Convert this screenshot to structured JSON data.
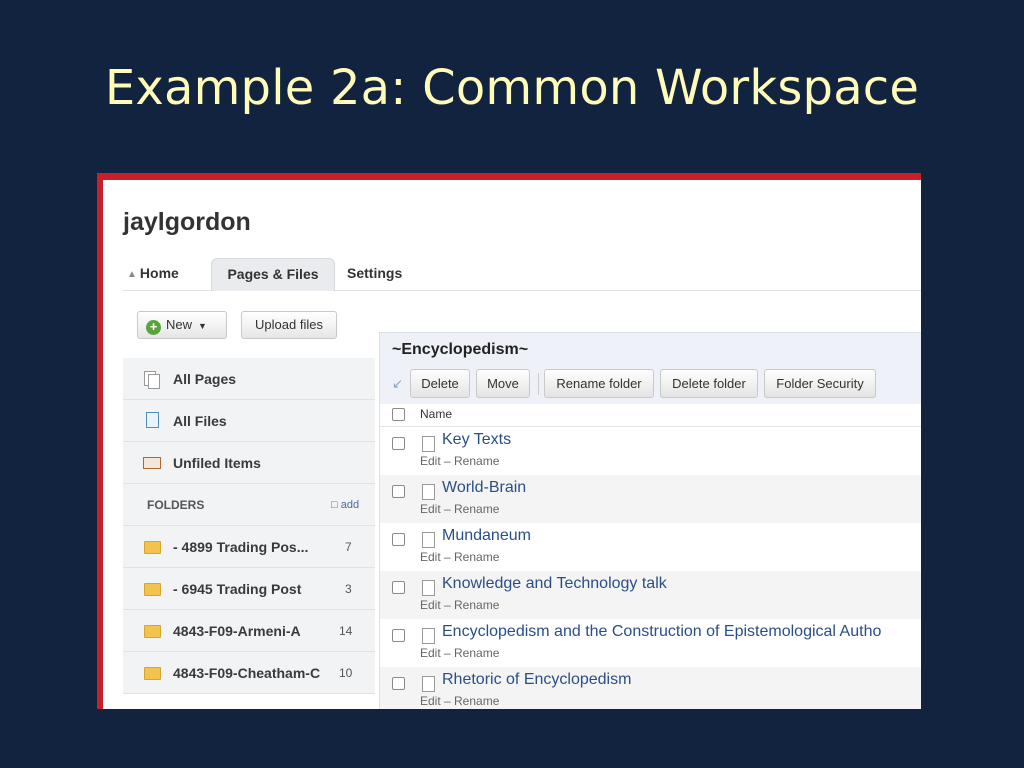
{
  "slide": {
    "title": "Example 2a: Common Workspace"
  },
  "app": {
    "user": "jaylgordon",
    "tabs": [
      {
        "label": "Home",
        "icon": "home-icon"
      },
      {
        "label": "Pages & Files"
      },
      {
        "label": "Settings"
      }
    ],
    "toolbar": {
      "new_label": "New",
      "upload_label": "Upload files"
    },
    "sidebar": {
      "items": [
        {
          "label": "All Pages",
          "icon": "pages-icon"
        },
        {
          "label": "All Files",
          "icon": "file-icon"
        },
        {
          "label": "Unfiled Items",
          "icon": "envelope-icon"
        }
      ],
      "folders_header": "FOLDERS",
      "add_label": "add",
      "folders": [
        {
          "label": "- 4899 Trading Pos...",
          "count": "7"
        },
        {
          "label": "- 6945 Trading Post",
          "count": "3"
        },
        {
          "label": "4843-F09-Armeni-A",
          "count": "14"
        },
        {
          "label": "4843-F09-Cheatham-C",
          "count": "10"
        }
      ]
    },
    "content": {
      "folder_title": "~Encyclopedism~",
      "actions": [
        "Delete",
        "Move",
        "Rename folder",
        "Delete folder",
        "Folder Security"
      ],
      "name_header": "Name",
      "links_text": "Edit – Rename",
      "rows": [
        {
          "title": "Key Texts"
        },
        {
          "title": "World-Brain"
        },
        {
          "title": "Mundaneum"
        },
        {
          "title": "Knowledge and Technology talk"
        },
        {
          "title": "Encyclopedism and the Construction of Epistemological Autho"
        },
        {
          "title": "Rhetoric of Encyclopedism"
        }
      ]
    }
  },
  "colors": {
    "background": "#12233f",
    "title": "#fffbb8",
    "frame": "#c8202a",
    "link": "#2a4f86"
  }
}
